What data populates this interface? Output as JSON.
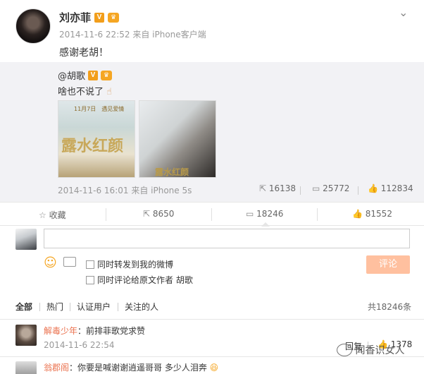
{
  "post": {
    "author": "刘亦菲",
    "timestamp": "2014-11-6 22:52",
    "source": "来自 iPhone客户端",
    "text": "感谢老胡！"
  },
  "repost": {
    "author": "@胡歌",
    "text": "啥也不说了",
    "poster1": {
      "date": "11月7日　遇见爱情",
      "title": "露水红颜"
    },
    "poster2": {
      "title": "露水红颜"
    },
    "timestamp": "2014-11-6 16:01",
    "source": "来自 iPhone 5s",
    "forwards": "16138",
    "comments": "25772",
    "likes": "112834"
  },
  "toolbar": {
    "favorite": "收藏",
    "forward": "8650",
    "comment": "18246",
    "like": "81552"
  },
  "composer": {
    "option_forward": "同时转发到我的微博",
    "option_comment_author": "同时评论给原文作者 胡歌",
    "submit": "评论"
  },
  "filters": {
    "all": "全部",
    "hot": "热门",
    "verified": "认证用户",
    "following": "关注的人",
    "total": "共18246条"
  },
  "comments": [
    {
      "user": "解毒少年",
      "text": "：前排菲歌党求赞",
      "timestamp": "2014-11-6 22:54",
      "reply": "回复",
      "likes": "1378"
    },
    {
      "user": "翁郡阁",
      "text": "：你要是喊谢谢逍遥哥哥 多少人泪奔"
    }
  ],
  "watermark": "闻香识女人",
  "colors": {
    "link": "#eb7350",
    "accent": "#f29e1b",
    "submit": "#ffc09f"
  }
}
